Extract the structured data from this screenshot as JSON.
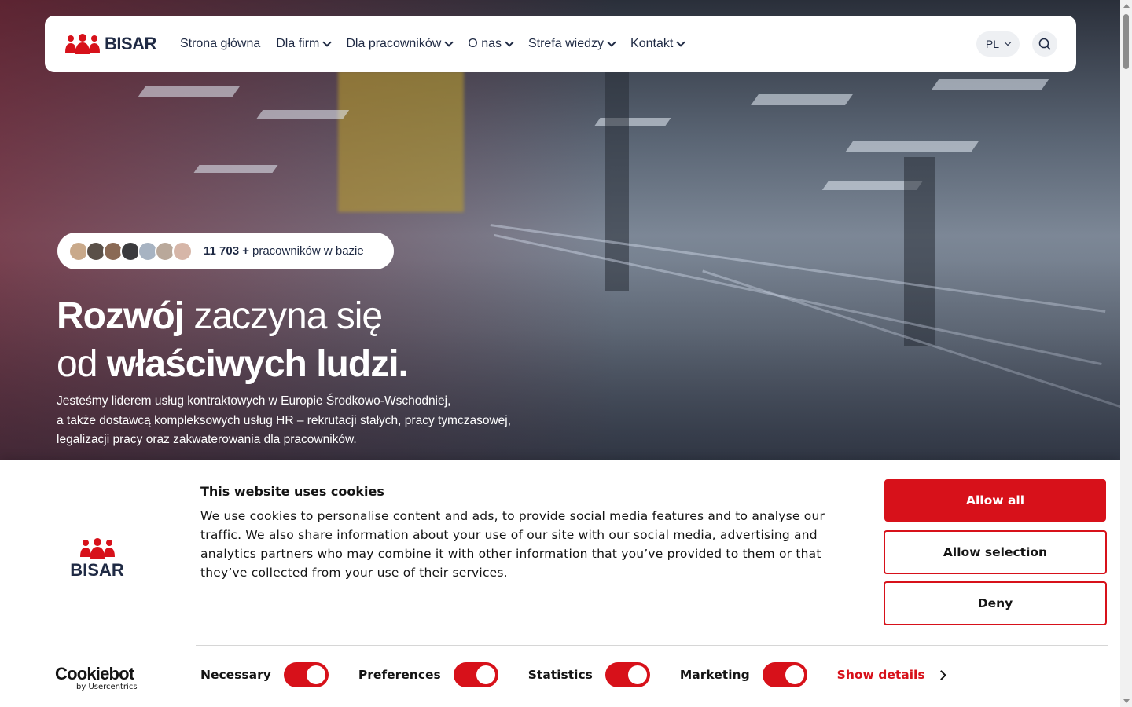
{
  "brand": {
    "name": "BISAR",
    "accent": "#d7111a",
    "navy": "#1f2a44"
  },
  "nav": {
    "items": [
      {
        "label": "Strona główna",
        "dropdown": false
      },
      {
        "label": "Dla firm",
        "dropdown": true
      },
      {
        "label": "Dla pracowników",
        "dropdown": true
      },
      {
        "label": "O nas",
        "dropdown": true
      },
      {
        "label": "Strefa wiedzy",
        "dropdown": true
      },
      {
        "label": "Kontakt",
        "dropdown": true
      }
    ],
    "language": "PL",
    "search_icon": "search-icon"
  },
  "hero": {
    "badge": {
      "count": "11 703 +",
      "text": "pracowników w bazie",
      "avatar_count": 7
    },
    "headline": {
      "line1_bold": "Rozwój",
      "line1_rest": "zaczyna się",
      "line2_start": "od",
      "line2_bold": "właściwych ludzi."
    },
    "lead": {
      "line1": "Jesteśmy liderem usług kontraktowych w Europie Środkowo-Wschodniej,",
      "line2": "a także dostawcą kompleksowych usług HR – rekrutacji stałych, pracy tymczasowej,",
      "line3": "legalizacji pracy oraz zakwaterowania dla pracowników."
    }
  },
  "cookie_banner": {
    "logo_text": "BISAR",
    "title": "This website uses cookies",
    "body": "We use cookies to personalise content and ads, to provide social media features and to analyse our traffic. We also share information about your use of our site with our social media, advertising and analytics partners who may combine it with other information that you’ve provided to them or that they’ve collected from your use of their services.",
    "buttons": {
      "allow_all": "Allow all",
      "allow_selection": "Allow selection",
      "deny": "Deny"
    },
    "toggles": [
      {
        "label": "Necessary",
        "on": true
      },
      {
        "label": "Preferences",
        "on": true
      },
      {
        "label": "Statistics",
        "on": true
      },
      {
        "label": "Marketing",
        "on": true
      }
    ],
    "show_details": "Show details",
    "provider": {
      "name": "Cookiebot",
      "sub": "by Usercentrics"
    }
  }
}
